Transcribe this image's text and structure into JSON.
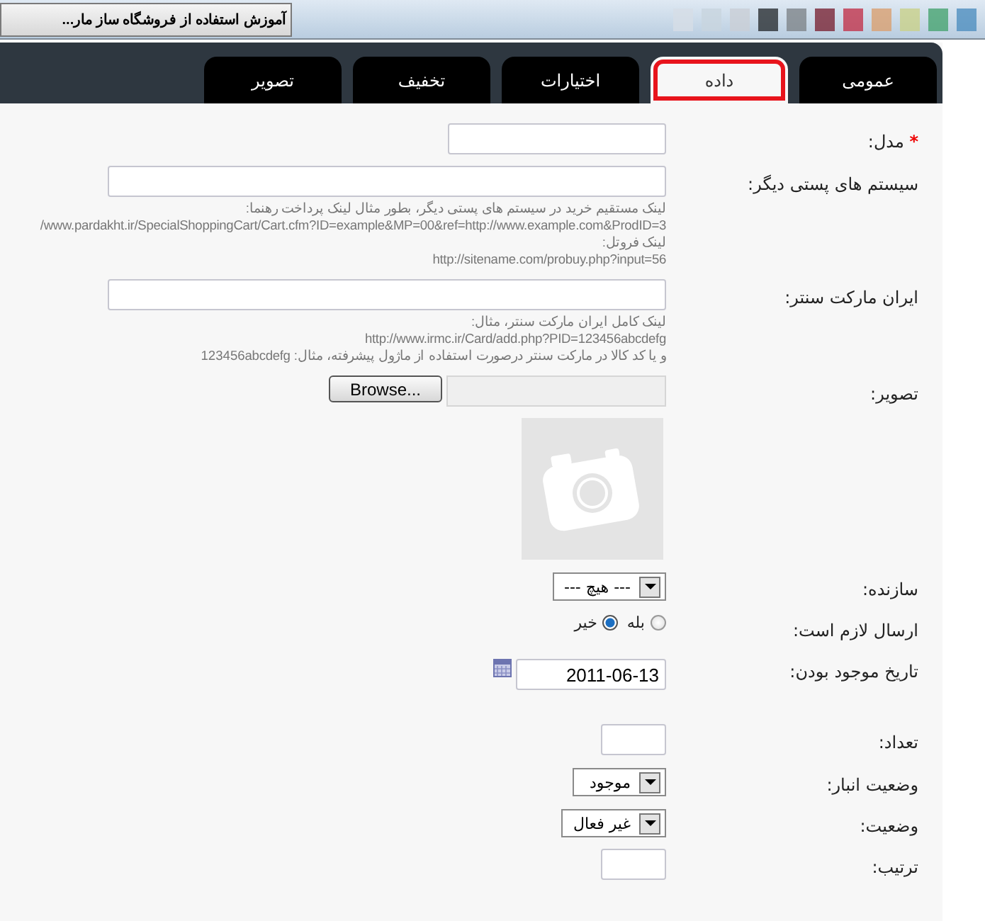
{
  "taskbar": {
    "window_button": "آموزش استفاده از فروشگاه ساز مار..."
  },
  "tabs": [
    {
      "label": "عمومی",
      "selected": false,
      "highlighted": false
    },
    {
      "label": "داده",
      "selected": true,
      "highlighted": true
    },
    {
      "label": "اختیارات",
      "selected": false,
      "highlighted": false
    },
    {
      "label": "تخفیف",
      "selected": false,
      "highlighted": false
    },
    {
      "label": "تصویر",
      "selected": false,
      "highlighted": false
    }
  ],
  "fields": [
    {
      "kind": "text",
      "label": "مدل:",
      "marker": "*"
    },
    {
      "kind": "url",
      "label": "سیستم های پستی دیگر:",
      "hints": [
        {
          "kind": "note",
          "text": "لینک مستقیم خرید در سیستم های پستی دیگر، بطور مثال لینک پرداخت رهنما:"
        },
        {
          "kind": "url",
          "text": "/www.pardakht.ir/SpecialShoppingCart/Cart.cfm?ID=example&MP=00&ref=http://www.example.com&ProdID=3"
        },
        {
          "kind": "note",
          "text": "لینک فروتل:"
        },
        {
          "kind": "url",
          "text": "http://sitename.com/probuy.php?input=56"
        }
      ]
    },
    {
      "kind": "url",
      "label": "ایران مارکت سنتر:",
      "hints": [
        {
          "kind": "note",
          "text": "لینک کامل ایران مارکت سنتر، مثال:"
        },
        {
          "kind": "url",
          "text": "http://www.irmc.ir/Card/add.php?PID=123456abcdefg"
        },
        {
          "kind": "note",
          "text": "و یا کد کالا در مارکت سنتر درصورت استفاده از ماژول پیشرفته، مثال: 123456abcdefg"
        }
      ]
    },
    {
      "kind": "file",
      "label": "تصویر:",
      "button": "Browse..."
    },
    {
      "kind": "image"
    },
    {
      "kind": "select",
      "label": "سازنده:",
      "value": "--- هیچ ---"
    },
    {
      "kind": "radio",
      "label": "ارسال لازم است:",
      "options": [
        {
          "label": "بله",
          "selected": false
        },
        {
          "label": "خیر",
          "selected": true
        }
      ]
    },
    {
      "kind": "date",
      "label": "تاریخ موجود بودن:",
      "value": "2011-06-13"
    },
    {
      "kind": "number",
      "label": "تعداد:"
    },
    {
      "kind": "select",
      "label": "وضعیت انبار:",
      "value": "موجود"
    },
    {
      "kind": "select",
      "label": "وضعیت:",
      "value": "غیر فعال"
    },
    {
      "kind": "number",
      "label": "ترتیب:"
    }
  ]
}
